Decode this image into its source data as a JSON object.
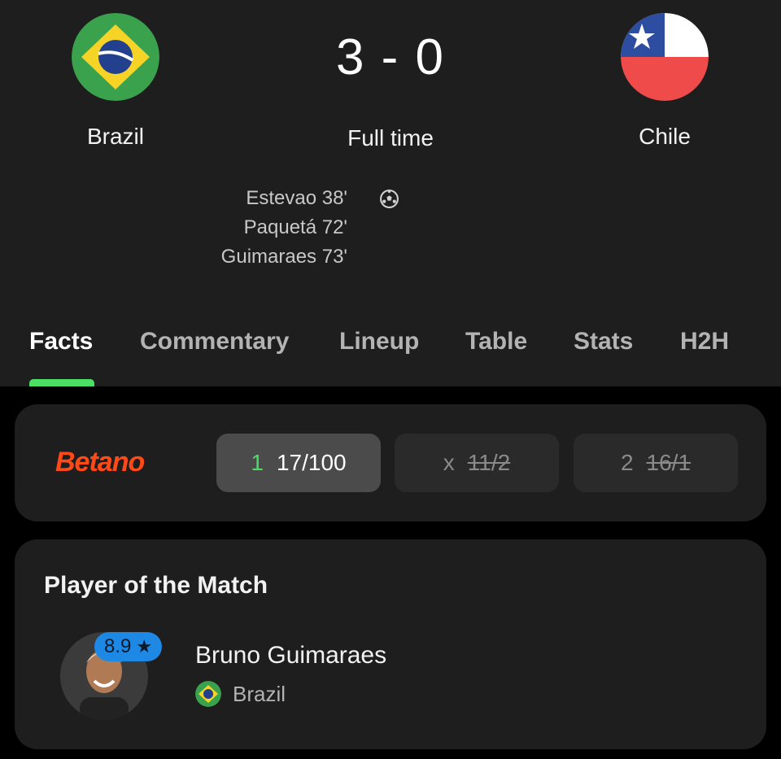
{
  "match": {
    "home": {
      "name": "Brazil",
      "flag_icon": "brazil-flag-icon"
    },
    "away": {
      "name": "Chile",
      "flag_icon": "chile-flag-icon"
    },
    "score": "3 - 0",
    "status": "Full time",
    "scorers": [
      "Estevao 38'",
      "Paquetá 72'",
      "Guimaraes 73'"
    ]
  },
  "tabs": [
    "Facts",
    "Commentary",
    "Lineup",
    "Table",
    "Stats",
    "H2H"
  ],
  "active_tab": "Facts",
  "odds": {
    "provider": "Betano",
    "options": [
      {
        "label": "1",
        "value": "17/100",
        "selected": true,
        "struck": false
      },
      {
        "label": "x",
        "value": "11/2",
        "selected": false,
        "struck": true
      },
      {
        "label": "2",
        "value": "16/1",
        "selected": false,
        "struck": true
      }
    ]
  },
  "potm": {
    "title": "Player of the Match",
    "rating": "8.9",
    "player_name": "Bruno Guimaraes",
    "country": "Brazil"
  },
  "colors": {
    "accent_green": "#4ade64",
    "betano_orange": "#ff4a17",
    "rating_blue": "#1e88e5"
  }
}
